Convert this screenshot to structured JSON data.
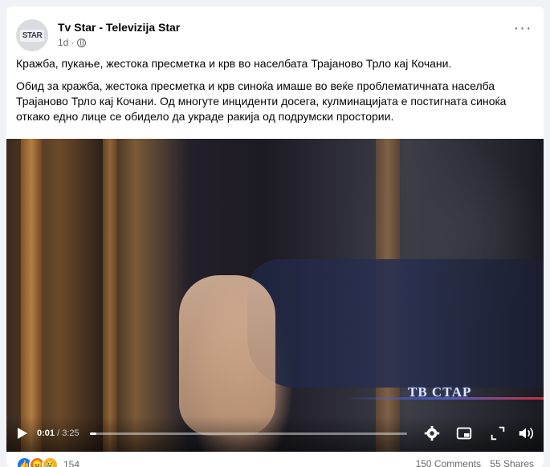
{
  "post": {
    "page_name": "Tv Star - Televizija Star",
    "time": "1d ·",
    "avatar_logo_text": "STAR",
    "title": "Кражба, пукање, жестока пресметка  и крв во  населбата Трајаново Трло кај Кочани.",
    "body": "Обид за кражба, жестока пресметка и крв синоќа имаше во веќе проблематичната населба Трајаново Трло кај Кочани. Од многуте инциденти досега, кулминацијата  е постигната синоќа   откако  едно лице  се обидело да украде ракија од подрумски простории."
  },
  "video": {
    "watermark": "ТВ СТАР",
    "current_time": "0:01",
    "duration": "3:25",
    "time_separator": " / ",
    "progress_fraction": 0.005
  },
  "footer": {
    "reaction_count": "154",
    "comments": "150 Comments",
    "shares": "55 Shares"
  },
  "icons": {
    "more": "more-options-icon",
    "play": "play-icon",
    "settings": "settings-icon",
    "pip": "picture-in-picture-icon",
    "fullscreen": "fullscreen-icon",
    "volume": "volume-icon"
  },
  "colors": {
    "like": "#1877f2",
    "angry": "#e9710f",
    "sad": "#f7b125"
  }
}
